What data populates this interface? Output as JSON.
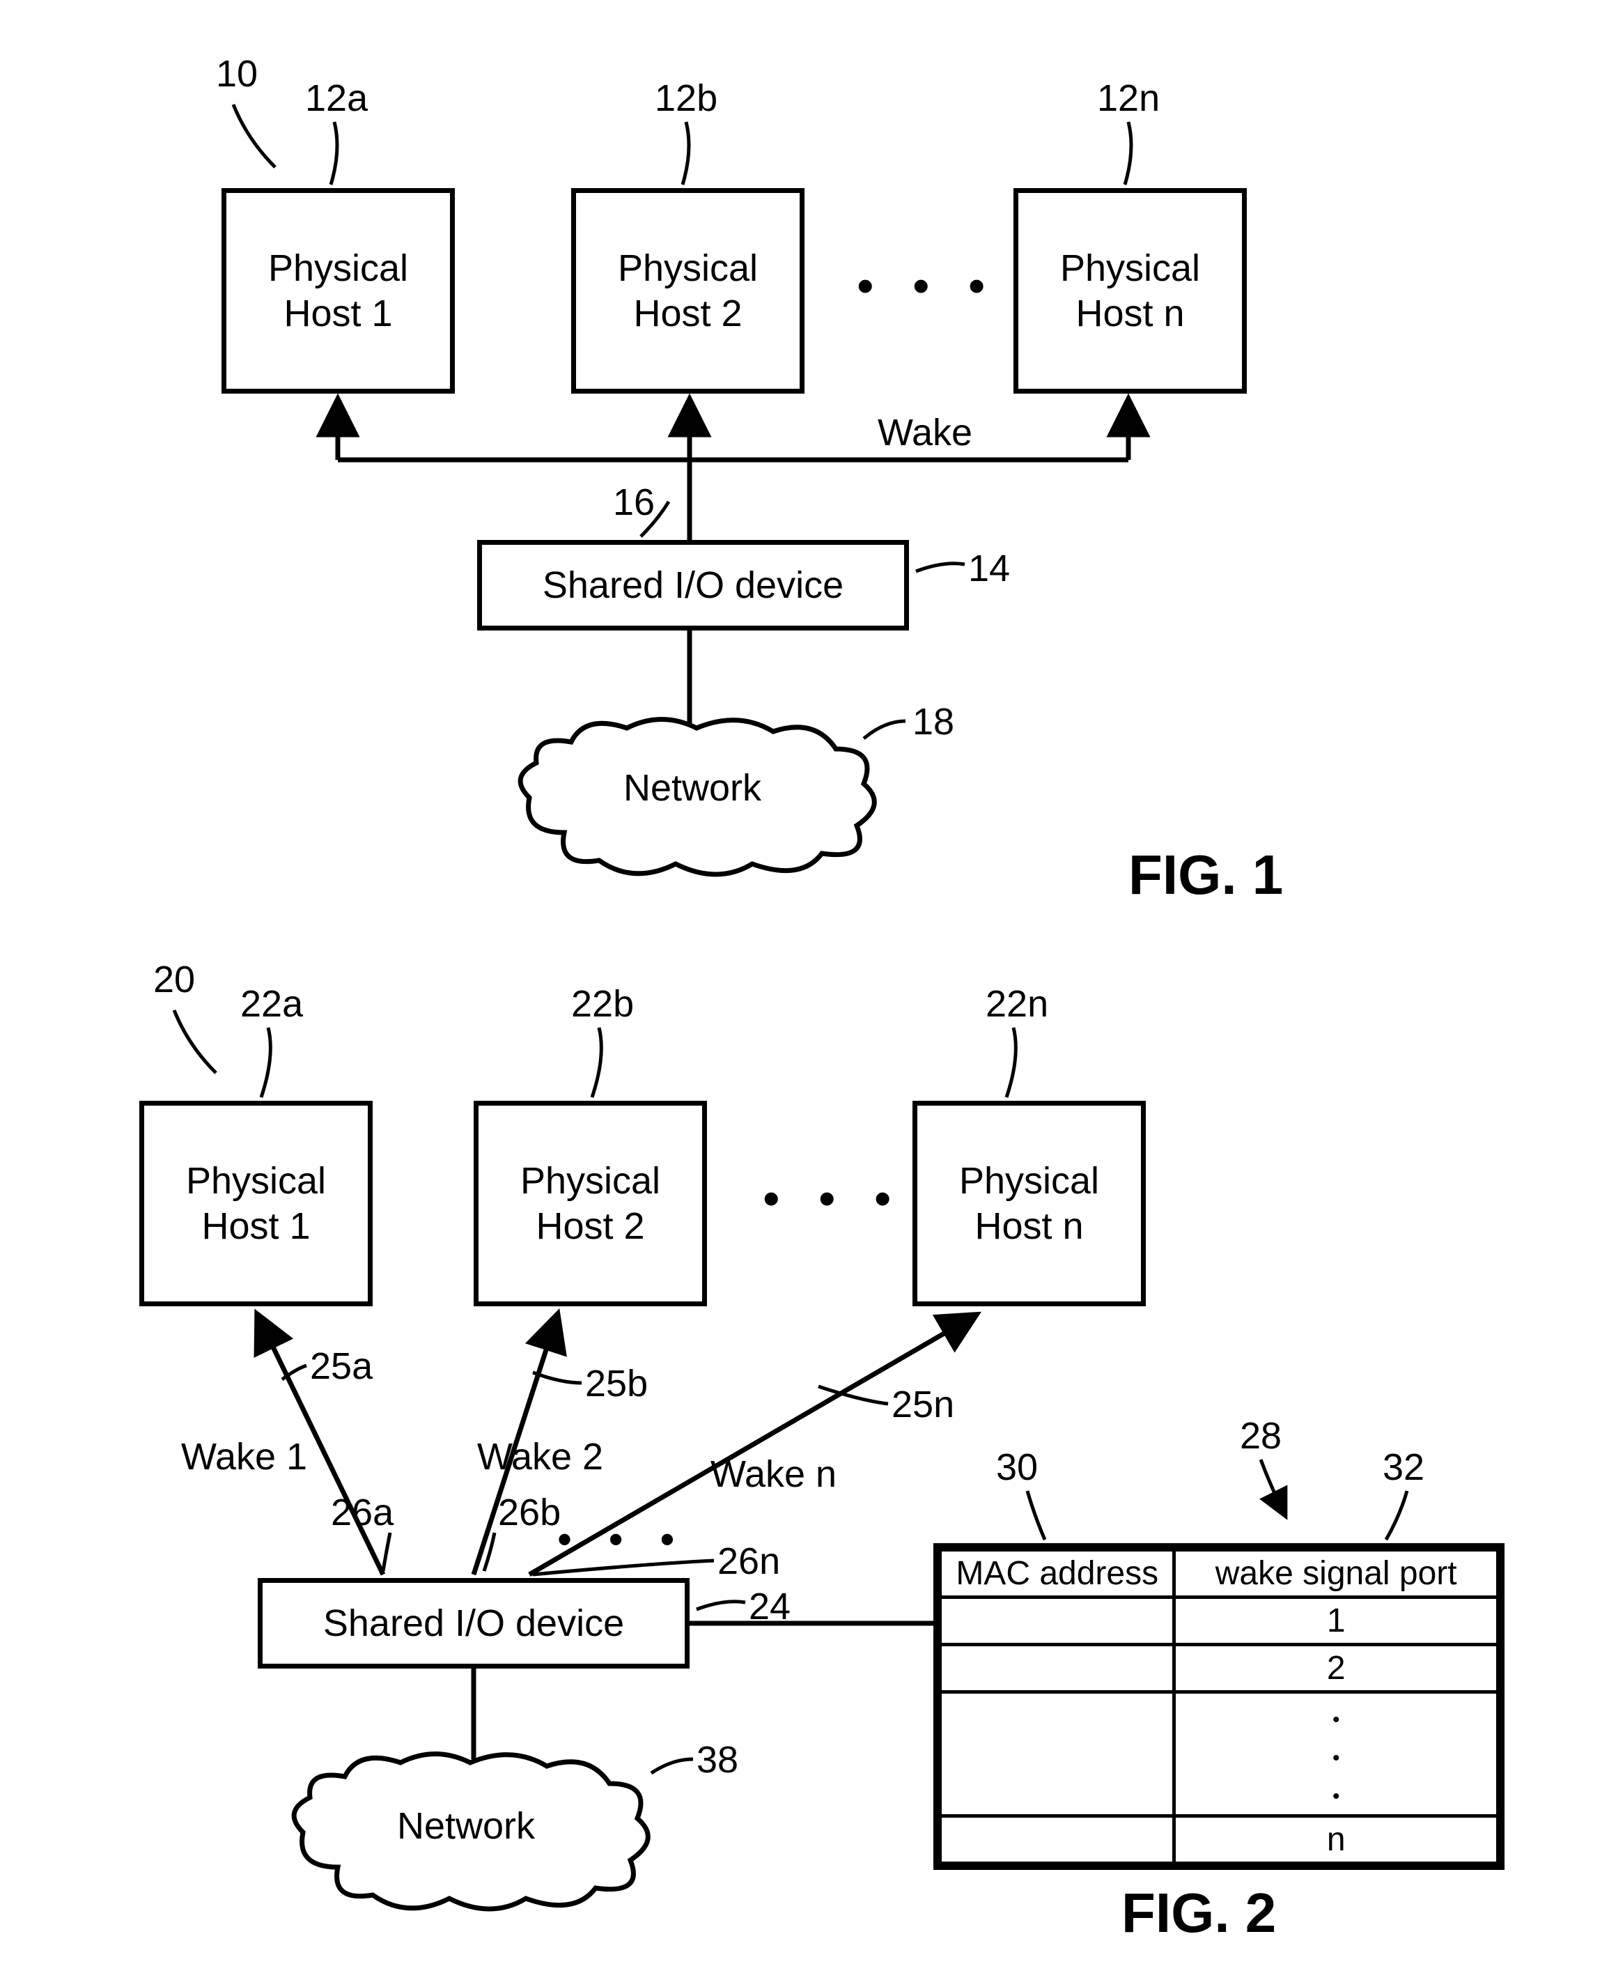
{
  "fig1": {
    "ref_main": "10",
    "hosts": [
      {
        "ref": "12a",
        "label": "Physical\nHost 1"
      },
      {
        "ref": "12b",
        "label": "Physical\nHost 2"
      },
      {
        "ref": "12n",
        "label": "Physical\nHost n"
      }
    ],
    "wake_label": "Wake",
    "io_ref_top": "16",
    "io_ref_side": "14",
    "io_label": "Shared I/O device",
    "net_ref": "18",
    "net_label": "Network",
    "caption": "FIG. 1"
  },
  "fig2": {
    "ref_main": "20",
    "hosts": [
      {
        "ref": "22a",
        "wake_ref": "25a",
        "port_ref": "26a",
        "wake_label": "Wake 1",
        "label": "Physical\nHost 1"
      },
      {
        "ref": "22b",
        "wake_ref": "25b",
        "port_ref": "26b",
        "wake_label": "Wake 2",
        "label": "Physical\nHost 2"
      },
      {
        "ref": "22n",
        "wake_ref": "25n",
        "port_ref": "26n",
        "wake_label": "Wake n",
        "label": "Physical\nHost n"
      }
    ],
    "io_ref": "24",
    "io_label": "Shared I/O device",
    "net_ref": "38",
    "net_label": "Network",
    "table": {
      "ref_main": "28",
      "col1_ref": "30",
      "col2_ref": "32",
      "col1_header": "MAC address",
      "col2_header": "wake signal port",
      "rows": [
        "1",
        "2",
        "…",
        "n"
      ]
    },
    "caption": "FIG. 2"
  },
  "chart_data": {
    "type": "table",
    "title": "MAC address to wake signal port mapping (ref 28)",
    "columns": [
      "MAC address",
      "wake signal port"
    ],
    "rows": [
      [
        "",
        "1"
      ],
      [
        "",
        "2"
      ],
      [
        "",
        "…"
      ],
      [
        "",
        "n"
      ]
    ]
  }
}
